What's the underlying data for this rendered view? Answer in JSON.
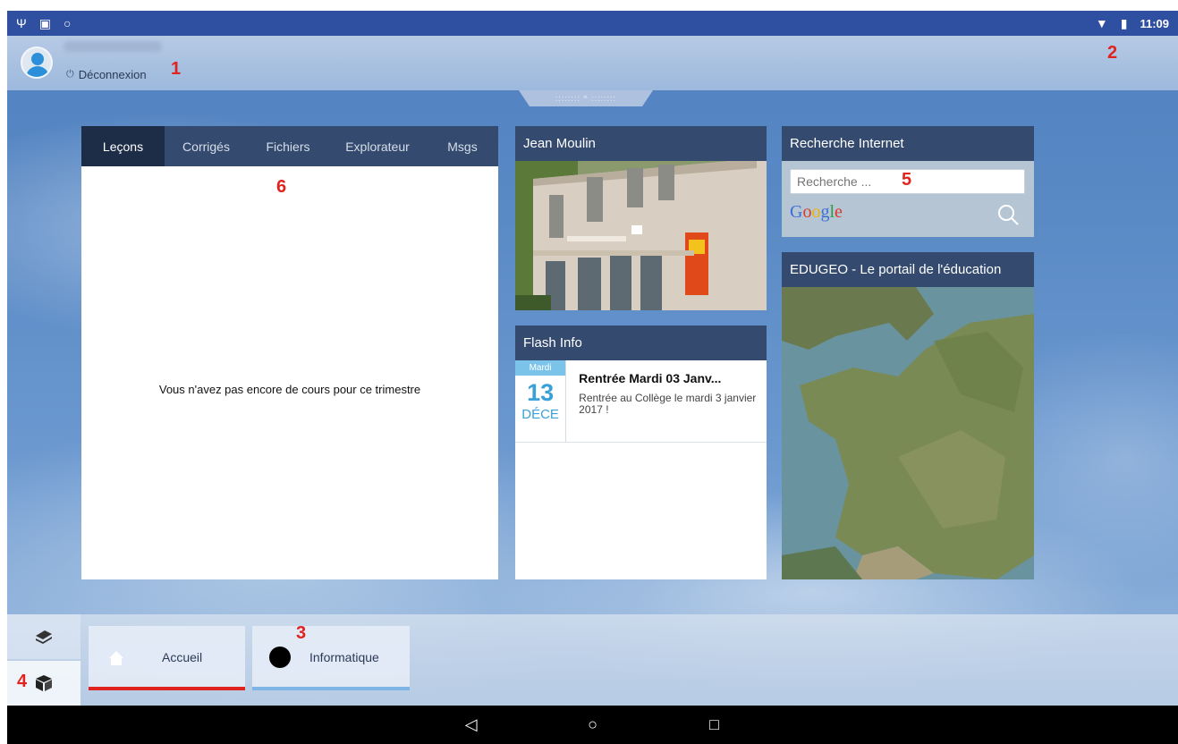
{
  "status_bar": {
    "left_icons": [
      "usb-icon",
      "sd-card-icon",
      "sync-icon"
    ],
    "right_icons": [
      "wifi-icon",
      "battery-icon"
    ],
    "time": "11:09"
  },
  "topbar": {
    "logout_label": "Déconnexion"
  },
  "annotations": [
    "1",
    "2",
    "3",
    "4",
    "5",
    "6"
  ],
  "lessons": {
    "tabs": [
      "Leçons",
      "Corrigés",
      "Fichiers",
      "Explorateur",
      "Msgs"
    ],
    "active_tab": "Leçons",
    "empty_message": "Vous n'avez pas encore de cours pour ce trimestre"
  },
  "school": {
    "title": "Jean Moulin"
  },
  "flash": {
    "title": "Flash Info",
    "item": {
      "day_name": "Mardi",
      "day": "13",
      "month": "DÉCE",
      "title": "Rentrée Mardi 03 Janv...",
      "body": "Rentrée au Collège le mardi 3 janvier 2017 !"
    }
  },
  "search": {
    "title": "Recherche Internet",
    "placeholder": "Recherche ...",
    "google": [
      "G",
      "o",
      "o",
      "g",
      "l",
      "e"
    ]
  },
  "edugeo": {
    "title": "EDUGEO - Le portail de l'éducation"
  },
  "bottom": {
    "tabs": [
      {
        "label": "Accueil",
        "accent": "#e0231f"
      },
      {
        "label": "Informatique",
        "accent": "#7fb4e6"
      }
    ]
  },
  "colors": {
    "header": "#344a6e",
    "accent_red": "#e0231f",
    "status_bar": "#2f4fa0"
  }
}
